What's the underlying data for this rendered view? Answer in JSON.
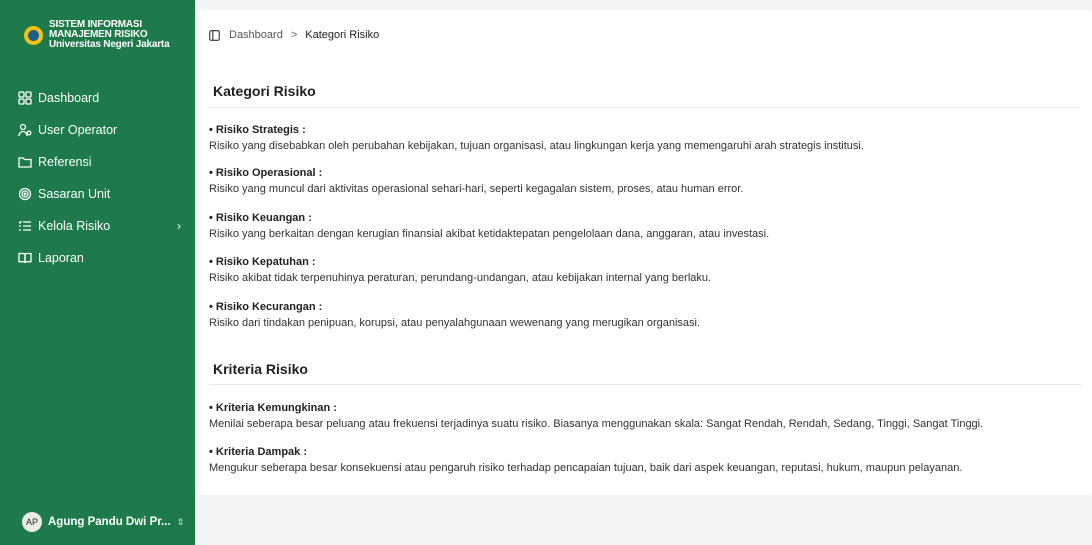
{
  "sidebar": {
    "brand": {
      "line1": "SISTEM INFORMASI",
      "line2": "MANAJEMEN RISIKO",
      "line3": "Universitas Negeri Jakarta"
    },
    "items": [
      {
        "label": "Dashboard",
        "icon": "grid-icon"
      },
      {
        "label": "User Operator",
        "icon": "users-icon"
      },
      {
        "label": "Referensi",
        "icon": "folder-icon"
      },
      {
        "label": "Sasaran Unit",
        "icon": "target-icon"
      },
      {
        "label": "Kelola Risiko",
        "icon": "list-icon"
      },
      {
        "label": "Laporan",
        "icon": "book-icon"
      }
    ],
    "user": {
      "initials": "AP",
      "name": "Agung Pandu Dwi Pr..."
    }
  },
  "breadcrumb": {
    "home": "Dashboard",
    "separator": ">",
    "current": "Kategori Risiko"
  },
  "kategori": {
    "title": "Kategori Risiko",
    "items": [
      {
        "title": "• Risiko Strategis :",
        "desc": "Risiko yang disebabkan oleh perubahan kebijakan, tujuan organisasi, atau lingkungan kerja yang memengaruhi arah strategis institusi."
      },
      {
        "title": "• Risiko Operasional :",
        "desc": "Risiko yang muncul dari aktivitas operasional sehari-hari, seperti kegagalan sistem, proses, atau human error."
      },
      {
        "title": "• Risiko Keuangan :",
        "desc": "Risiko yang berkaitan dengan kerugian finansial akibat ketidaktepatan pengelolaan dana, anggaran, atau investasi."
      },
      {
        "title": "• Risiko Kepatuhan :",
        "desc": "Risiko akibat tidak terpenuhinya peraturan, perundang-undangan, atau kebijakan internal yang berlaku."
      },
      {
        "title": "• Risiko Kecurangan :",
        "desc": "Risiko dari tindakan penipuan, korupsi, atau penyalahgunaan wewenang yang merugikan organisasi."
      }
    ]
  },
  "kriteria": {
    "title": "Kriteria Risiko",
    "items": [
      {
        "title": "• Kriteria Kemungkinan :",
        "desc": "Menilai seberapa besar peluang atau frekuensi terjadinya suatu risiko. Biasanya menggunakan skala: Sangat Rendah, Rendah, Sedang, Tinggi, Sangat Tinggi."
      },
      {
        "title": "• Kriteria Dampak :",
        "desc": "Mengukur seberapa besar konsekuensi atau pengaruh risiko terhadap pencapaian tujuan, baik dari aspek keuangan, reputasi, hukum, maupun pelayanan."
      }
    ]
  },
  "colors": {
    "sidebar": "#1e7a4b",
    "logo": "#f4c30f"
  }
}
